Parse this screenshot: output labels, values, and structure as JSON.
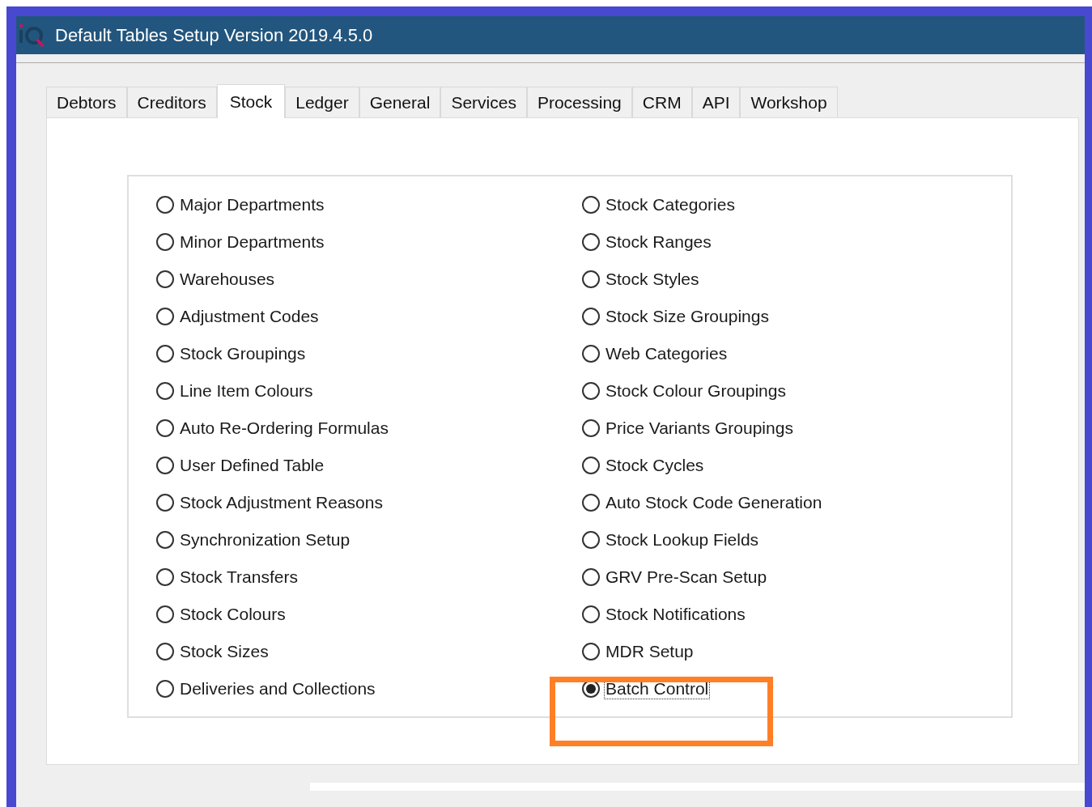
{
  "window": {
    "title": "Default Tables Setup Version 2019.4.5.0"
  },
  "tabs": [
    {
      "label": "Debtors",
      "selected": false
    },
    {
      "label": "Creditors",
      "selected": false
    },
    {
      "label": "Stock",
      "selected": true
    },
    {
      "label": "Ledger",
      "selected": false
    },
    {
      "label": "General",
      "selected": false
    },
    {
      "label": "Services",
      "selected": false
    },
    {
      "label": "Processing",
      "selected": false
    },
    {
      "label": "CRM",
      "selected": false
    },
    {
      "label": "API",
      "selected": false
    },
    {
      "label": "Workshop",
      "selected": false
    }
  ],
  "options": {
    "columns": [
      [
        {
          "label": "Major Departments",
          "selected": false
        },
        {
          "label": "Minor Departments",
          "selected": false
        },
        {
          "label": "Warehouses",
          "selected": false
        },
        {
          "label": "Adjustment Codes",
          "selected": false
        },
        {
          "label": "Stock Groupings",
          "selected": false
        },
        {
          "label": "Line Item Colours",
          "selected": false
        },
        {
          "label": "Auto Re-Ordering Formulas",
          "selected": false
        },
        {
          "label": "User Defined Table",
          "selected": false
        },
        {
          "label": "Stock Adjustment Reasons",
          "selected": false
        },
        {
          "label": "Synchronization Setup",
          "selected": false
        },
        {
          "label": "Stock Transfers",
          "selected": false
        },
        {
          "label": "Stock Colours",
          "selected": false
        },
        {
          "label": "Stock Sizes",
          "selected": false
        },
        {
          "label": "Deliveries and Collections",
          "selected": false
        }
      ],
      [
        {
          "label": "Stock Categories",
          "selected": false
        },
        {
          "label": "Stock Ranges",
          "selected": false
        },
        {
          "label": "Stock Styles",
          "selected": false
        },
        {
          "label": "Stock Size Groupings",
          "selected": false
        },
        {
          "label": "Web Categories",
          "selected": false
        },
        {
          "label": "Stock Colour Groupings",
          "selected": false
        },
        {
          "label": "Price Variants Groupings",
          "selected": false
        },
        {
          "label": "Stock Cycles",
          "selected": false
        },
        {
          "label": "Auto Stock Code Generation",
          "selected": false
        },
        {
          "label": "Stock Lookup Fields",
          "selected": false
        },
        {
          "label": "GRV Pre-Scan Setup",
          "selected": false
        },
        {
          "label": "Stock Notifications",
          "selected": false
        },
        {
          "label": "MDR Setup",
          "selected": false
        },
        {
          "label": "Batch Control",
          "selected": true
        }
      ]
    ]
  }
}
